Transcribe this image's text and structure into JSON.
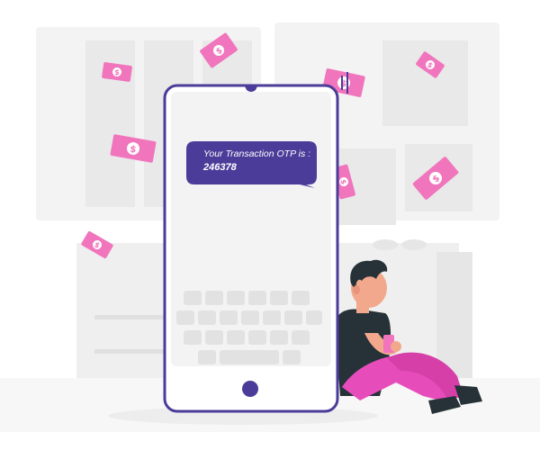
{
  "message": {
    "line1": "Your Transaction OTP is :",
    "line2": "246378"
  },
  "colors": {
    "accent": "#4B3C99",
    "bubble": "#4B3C99",
    "money": "#F075BD",
    "pants": "#E64DBA",
    "background_shapes": "#F3F3F3"
  },
  "icons": [
    "money-bill-icon",
    "home-button-icon",
    "notch-icon",
    "vibration-icon"
  ]
}
